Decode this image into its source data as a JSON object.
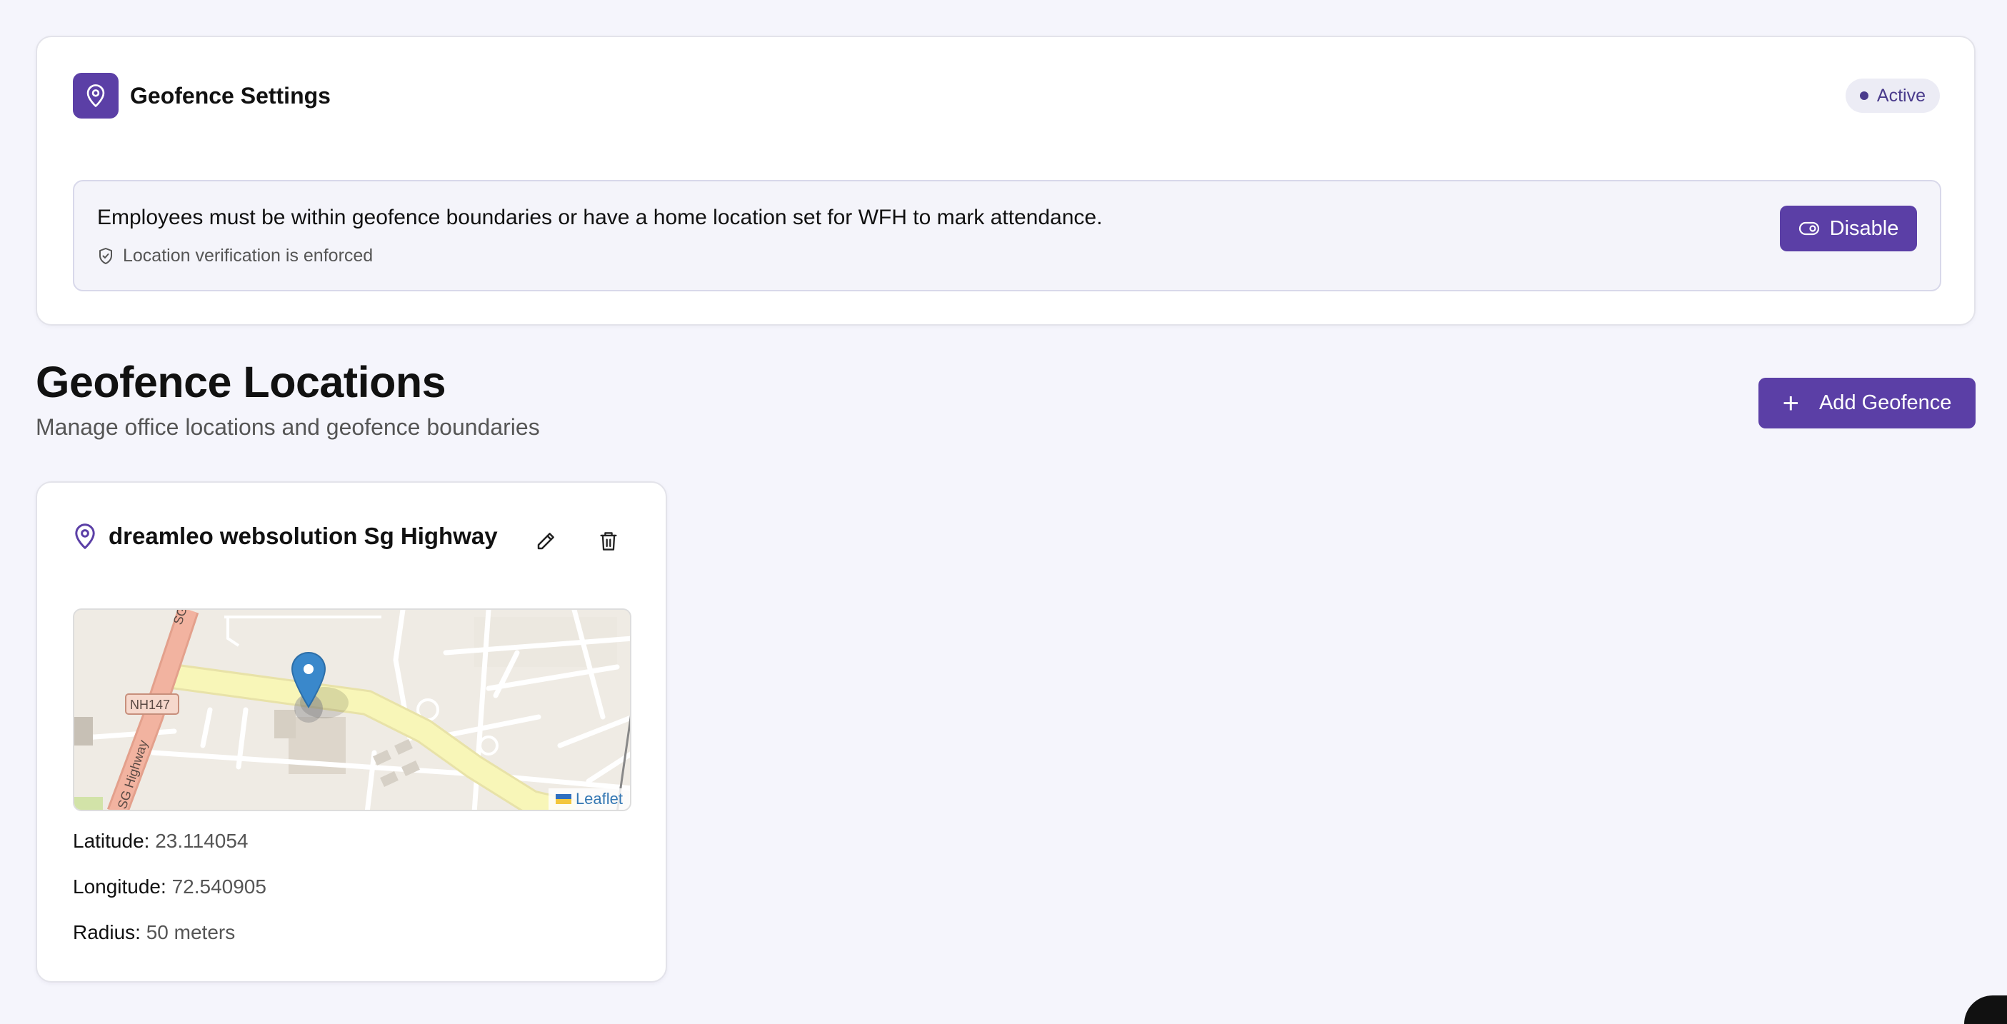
{
  "settings": {
    "title": "Geofence Settings",
    "status": "Active",
    "notice": "Employees must be within geofence boundaries or have a home location set for WFH to mark attendance.",
    "enforced": "Location verification is enforced",
    "disable_label": "Disable"
  },
  "section": {
    "title": "Geofence Locations",
    "subtitle": "Manage office locations and geofence boundaries",
    "add_label": "Add Geofence"
  },
  "locations": [
    {
      "name": "dreamleo websolution Sg Highway",
      "map": {
        "road_labels": [
          "SG Hig",
          "NH147",
          "SG Highway"
        ],
        "attribution": "Leaflet"
      },
      "latitude_label": "Latitude:",
      "latitude": "23.114054",
      "longitude_label": "Longitude:",
      "longitude": "72.540905",
      "radius_label": "Radius:",
      "radius": "50 meters"
    }
  ],
  "colors": {
    "accent": "#5b3fa6",
    "background": "#f5f5fc",
    "badge_bg": "#ececf5"
  },
  "icons": [
    "map-pin-icon",
    "shield-check-icon",
    "toggle-icon",
    "plus-icon",
    "pencil-icon",
    "trash-icon",
    "marker-icon"
  ]
}
